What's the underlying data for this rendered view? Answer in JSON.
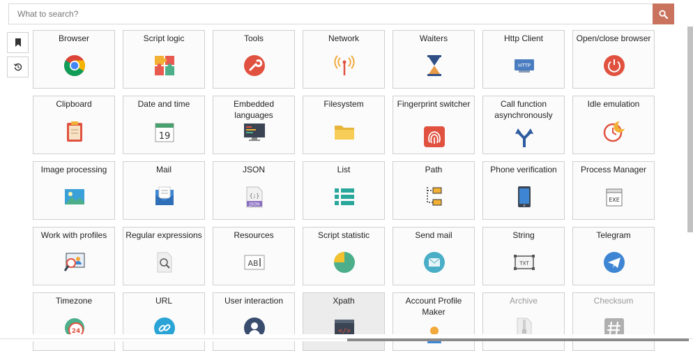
{
  "search": {
    "placeholder": "What to search?"
  },
  "sidebar": [
    {
      "name": "bookmark-button",
      "icon": "bookmark-icon"
    },
    {
      "name": "history-button",
      "icon": "history-icon"
    }
  ],
  "tiles": [
    {
      "label": "Browser",
      "icon": "chrome"
    },
    {
      "label": "Script logic",
      "icon": "puzzle"
    },
    {
      "label": "Tools",
      "icon": "wrench"
    },
    {
      "label": "Network",
      "icon": "antenna"
    },
    {
      "label": "Waiters",
      "icon": "hourglass"
    },
    {
      "label": "Http Client",
      "icon": "http"
    },
    {
      "label": "Open/close browser",
      "icon": "power"
    },
    {
      "label": "Clipboard",
      "icon": "clipboard"
    },
    {
      "label": "Date and time",
      "icon": "calendar",
      "icon_text": "19"
    },
    {
      "label": "Embedded languages",
      "icon": "monitor-code"
    },
    {
      "label": "Filesystem",
      "icon": "folder"
    },
    {
      "label": "Fingerprint switcher",
      "icon": "fingerprint"
    },
    {
      "label": "Call function asynchronously",
      "icon": "split-arrows"
    },
    {
      "label": "Idle emulation",
      "icon": "clock-moon"
    },
    {
      "label": "Image processing",
      "icon": "image"
    },
    {
      "label": "Mail",
      "icon": "envelope"
    },
    {
      "label": "JSON",
      "icon": "json-file",
      "icon_text": "{;}"
    },
    {
      "label": "List",
      "icon": "list"
    },
    {
      "label": "Path",
      "icon": "path-tree"
    },
    {
      "label": "Phone verification",
      "icon": "phone"
    },
    {
      "label": "Process Manager",
      "icon": "exe",
      "icon_text": "EXE"
    },
    {
      "label": "Work with profiles",
      "icon": "profile-search"
    },
    {
      "label": "Regular expressions",
      "icon": "regex-doc"
    },
    {
      "label": "Resources",
      "icon": "ab-box",
      "icon_text": "AB"
    },
    {
      "label": "Script statistic",
      "icon": "pie"
    },
    {
      "label": "Send mail",
      "icon": "send-mail"
    },
    {
      "label": "String",
      "icon": "txt-box",
      "icon_text": "TXT"
    },
    {
      "label": "Telegram",
      "icon": "telegram"
    },
    {
      "label": "Timezone",
      "icon": "globe-24",
      "icon_text": "24"
    },
    {
      "label": "URL",
      "icon": "link"
    },
    {
      "label": "User interaction",
      "icon": "user"
    },
    {
      "label": "Xpath",
      "icon": "xpath",
      "state": "hover"
    },
    {
      "label": "Account Profile Maker",
      "icon": "account-maker"
    },
    {
      "label": "Archive",
      "icon": "archive",
      "state": "disabled"
    },
    {
      "label": "Checksum",
      "icon": "hash",
      "state": "disabled"
    }
  ]
}
